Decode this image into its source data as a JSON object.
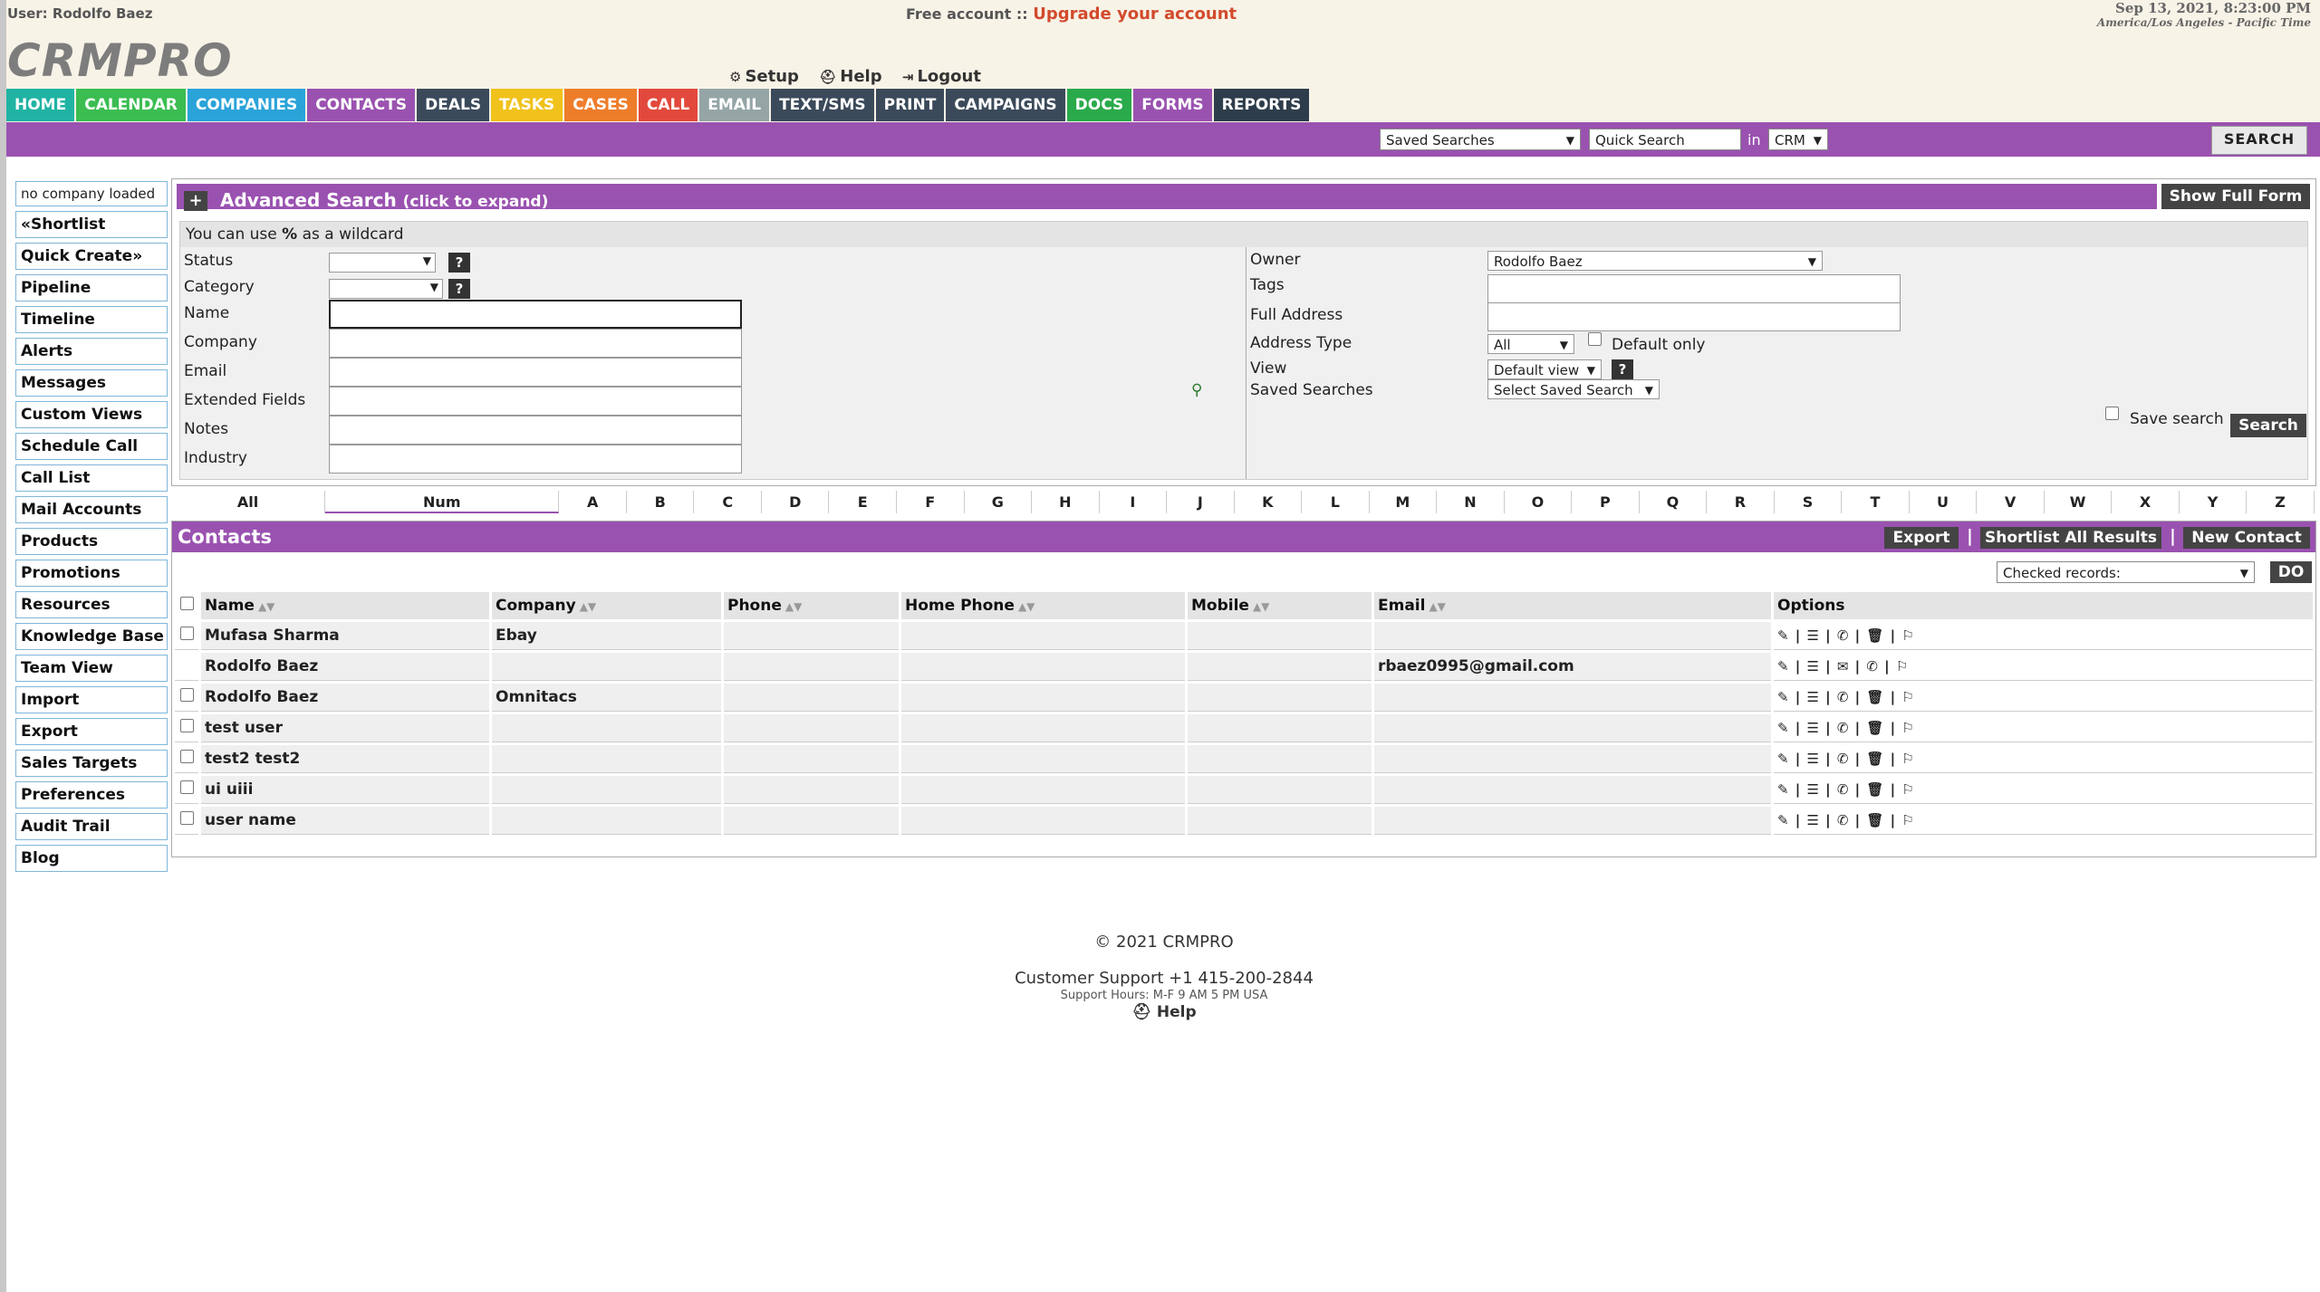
{
  "header": {
    "user_info": "User: Rodolfo Baez",
    "free_account": "Free account ::",
    "upgrade_link": "Upgrade your account",
    "datetime": "Sep 13, 2021, 8:23:00 PM",
    "timezone": "America/Los Angeles - Pacific Time",
    "logo": "CRMPRO",
    "links": {
      "setup": "Setup",
      "help": "Help",
      "logout": "Logout"
    }
  },
  "nav": [
    {
      "label": "HOME",
      "color": "#20b3a3"
    },
    {
      "label": "CALENDAR",
      "color": "#3bbd52"
    },
    {
      "label": "COMPANIES",
      "color": "#2aa3d9"
    },
    {
      "label": "CONTACTS",
      "color": "#9a52b0"
    },
    {
      "label": "DEALS",
      "color": "#3b4a5a"
    },
    {
      "label": "TASKS",
      "color": "#f1c21b"
    },
    {
      "label": "CASES",
      "color": "#ee7d2a"
    },
    {
      "label": "CALL",
      "color": "#e2493c"
    },
    {
      "label": "EMAIL",
      "color": "#95a5a6"
    },
    {
      "label": "TEXT/SMS",
      "color": "#3b4a5a"
    },
    {
      "label": "PRINT",
      "color": "#3b4a5a"
    },
    {
      "label": "CAMPAIGNS",
      "color": "#3b4a5a"
    },
    {
      "label": "DOCS",
      "color": "#2aaa4b"
    },
    {
      "label": "FORMS",
      "color": "#9a52b0"
    },
    {
      "label": "REPORTS",
      "color": "#2e3d4b"
    }
  ],
  "search_bar": {
    "saved_searches": "Saved Searches",
    "quick_search_placeholder": "Quick Search",
    "in_label": "in",
    "scope": "CRM",
    "search_button": "SEARCH"
  },
  "sidebar": {
    "no_company": "no company loaded",
    "items": [
      "«Shortlist",
      "Quick Create»",
      "Pipeline",
      "Timeline",
      "Alerts",
      "Messages",
      "Custom Views",
      "Schedule Call",
      "Call List",
      "Mail Accounts",
      "Products",
      "Promotions",
      "Resources",
      "Knowledge Base",
      "Team View",
      "Import",
      "Export",
      "Sales Targets",
      "Preferences",
      "Audit Trail",
      "Blog"
    ]
  },
  "advanced_search": {
    "plus": "+",
    "title": "Advanced Search",
    "title_hint": "(click to expand)",
    "show_full_form": "Show Full Form",
    "wildcard_prefix": "You can use",
    "wildcard_symbol": "%",
    "wildcard_suffix": "as a wildcard",
    "left_labels": [
      "Status",
      "Category",
      "Name",
      "Company",
      "Email",
      "Extended Fields",
      "Notes",
      "Industry"
    ],
    "owner_label": "Owner",
    "owner_value": "Rodolfo Baez",
    "tags_label": "Tags",
    "full_address_label": "Full Address",
    "address_type_label": "Address Type",
    "address_type_value": "All",
    "default_only": "Default only",
    "view_label": "View",
    "view_value": "Default view",
    "saved_searches_label": "Saved Searches",
    "saved_searches_value": "Select Saved Search",
    "save_search": "Save search",
    "search_button": "Search",
    "help_mark": "?"
  },
  "alpha": [
    "All",
    "Num",
    "A",
    "B",
    "C",
    "D",
    "E",
    "F",
    "G",
    "H",
    "I",
    "J",
    "K",
    "L",
    "M",
    "N",
    "O",
    "P",
    "Q",
    "R",
    "S",
    "T",
    "U",
    "V",
    "W",
    "X",
    "Y",
    "Z"
  ],
  "contacts": {
    "title": "Contacts",
    "export": "Export",
    "shortlist_all": "Shortlist All Results",
    "new_contact": "New Contact",
    "separator": "|",
    "checked_records": "Checked records:",
    "do": "DO",
    "columns": [
      "Name",
      "Company",
      "Phone",
      "Home Phone",
      "Mobile",
      "Email",
      "Options"
    ],
    "rows": [
      {
        "name": "Mufasa Sharma",
        "company": "Ebay",
        "phone": "",
        "home": "",
        "mobile": "",
        "email": "",
        "options": "✎ | ☰ | ✆ | 🗑 | ⚐",
        "checkbox": true
      },
      {
        "name": "Rodolfo Baez",
        "company": "",
        "phone": "",
        "home": "",
        "mobile": "",
        "email": "rbaez0995@gmail.com",
        "options": "✎ | ☰ | ✉ | ✆ | ⚐",
        "checkbox": false
      },
      {
        "name": "Rodolfo Baez",
        "company": "Omnitacs",
        "phone": "",
        "home": "",
        "mobile": "",
        "email": "",
        "options": "✎ | ☰ | ✆ | 🗑 | ⚐",
        "checkbox": true
      },
      {
        "name": "test user",
        "company": "",
        "phone": "",
        "home": "",
        "mobile": "",
        "email": "",
        "options": "✎ | ☰ | ✆ | 🗑 | ⚐",
        "checkbox": true
      },
      {
        "name": "test2 test2",
        "company": "",
        "phone": "",
        "home": "",
        "mobile": "",
        "email": "",
        "options": "✎ | ☰ | ✆ | 🗑 | ⚐",
        "checkbox": true
      },
      {
        "name": "ui uiii",
        "company": "",
        "phone": "",
        "home": "",
        "mobile": "",
        "email": "",
        "options": "✎ | ☰ | ✆ | 🗑 | ⚐",
        "checkbox": true
      },
      {
        "name": "user name",
        "company": "",
        "phone": "",
        "home": "",
        "mobile": "",
        "email": "",
        "options": "✎ | ☰ | ✆ | 🗑 | ⚐",
        "checkbox": true
      }
    ]
  },
  "footer": {
    "copyright": "© 2021 CRMPRO",
    "support": "Customer Support +1 415-200-2844",
    "hours": "Support Hours: M-F 9 AM 5 PM USA",
    "help": "Help"
  }
}
